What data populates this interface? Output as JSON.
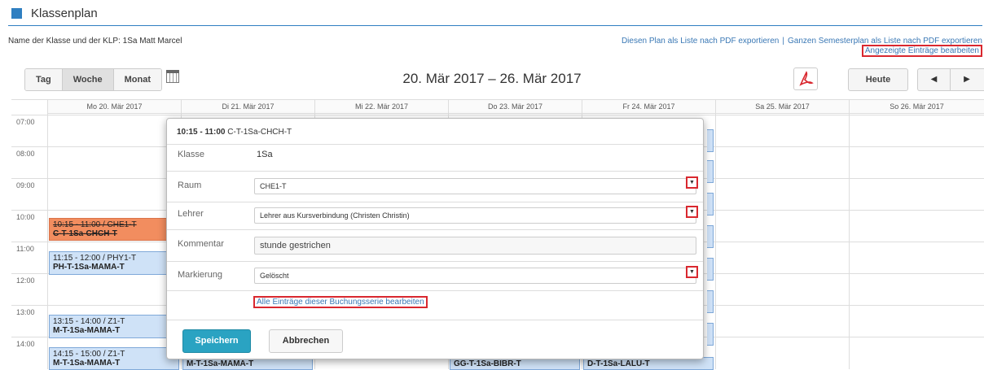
{
  "header": {
    "title": "Klassenplan",
    "klp_name": "Name der Klasse und der KLP: 1Sa Matt Marcel",
    "link_export_list": "Diesen Plan als Liste nach PDF exportieren",
    "link_separator": "|",
    "link_export_semester": "Ganzen Semesterplan als Liste nach PDF exportieren",
    "link_edit_entries": "Angezeigte Einträge bearbeiten"
  },
  "toolbar": {
    "view_day": "Tag",
    "view_week": "Woche",
    "view_month": "Monat",
    "active_view": "Woche",
    "date_range": "20. Mär 2017 – 26. Mär 2017",
    "today_label": "Heute",
    "prev_icon": "◀",
    "next_icon": "▶"
  },
  "calendar": {
    "days": [
      "Mo 20. Mär 2017",
      "Di 21. Mär 2017",
      "Mi 22. Mär 2017",
      "Do 23. Mär 2017",
      "Fr 24. Mär 2017",
      "Sa 25. Mär 2017",
      "So 26. Mär 2017"
    ],
    "hours": [
      "07:00",
      "08:00",
      "09:00",
      "10:00",
      "11:00",
      "12:00",
      "13:00",
      "14:00"
    ],
    "events": [
      {
        "time": "10:15 - 11:00 / CHE1-T",
        "title": "C-T-1Sa-CHCH-T",
        "status": "cancelled"
      },
      {
        "time": "11:15 - 12:00 / PHY1-T",
        "title": "PH-T-1Sa-MAMA-T",
        "status": "normal"
      },
      {
        "time": "13:15 - 14:00 / Z1-T",
        "title": "M-T-1Sa-MAMA-T",
        "status": "normal"
      },
      {
        "time": "14:15 - 15:00 / Z1-T",
        "title": "M-T-1Sa-MAMA-T",
        "status": "normal"
      },
      {
        "time": "",
        "title": "M-T-1Sa-MAMA-T",
        "status": "normal"
      },
      {
        "time": "",
        "title": "GG-T-1Sa-BIBR-T",
        "status": "normal"
      },
      {
        "time": "",
        "title": "D-T-1Sa-LALU-T",
        "status": "normal"
      }
    ]
  },
  "popup": {
    "time": "10:15 - 11:00",
    "title": "C-T-1Sa-CHCH-T",
    "klasse_label": "Klasse",
    "klasse_value": "1Sa",
    "raum_label": "Raum",
    "raum_value": "CHE1-T",
    "lehrer_label": "Lehrer",
    "lehrer_value": "Lehrer aus Kursverbindung (Christen Christin)",
    "kommentar_label": "Kommentar",
    "kommentar_value": "stunde gestrichen",
    "markierung_label": "Markierung",
    "markierung_value": "Gelöscht",
    "series_link": "Alle Einträge dieser Buchungsserie bearbeiten",
    "save_label": "Speichern",
    "cancel_label": "Abbrechen",
    "select_arrow": "▼"
  },
  "colors": {
    "accent": "#2f7fc1",
    "event_bg": "#cfe2f7",
    "cancelled_bg": "#f28d5f",
    "save_button": "#2aa3c2",
    "highlight_box": "#d9282f"
  }
}
